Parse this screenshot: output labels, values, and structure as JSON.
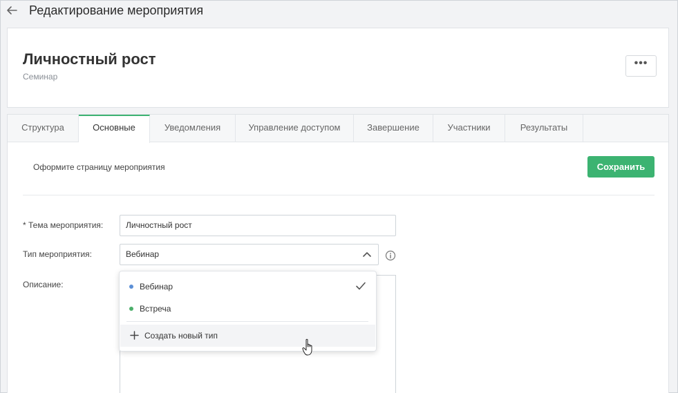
{
  "header": {
    "title": "Редактирование мероприятия"
  },
  "event": {
    "title": "Личностный рост",
    "subtitle": "Семинар",
    "more_label": "•••"
  },
  "tabs": [
    {
      "label": "Структура"
    },
    {
      "label": "Основные"
    },
    {
      "label": "Уведомления"
    },
    {
      "label": "Управление доступом"
    },
    {
      "label": "Завершение"
    },
    {
      "label": "Участники"
    },
    {
      "label": "Результаты"
    }
  ],
  "active_tab": "Основные",
  "section": {
    "label": "Оформите страницу мероприятия",
    "save_label": "Сохранить"
  },
  "form": {
    "topic_label": "* Тема мероприятия:",
    "topic_value": "Личностный рост",
    "type_label": "Тип мероприятия:",
    "type_value": "Вебинар",
    "description_label": "Описание:"
  },
  "dropdown": {
    "options": [
      {
        "label": "Вебинар",
        "color": "#5b8fd6",
        "selected": true
      },
      {
        "label": "Встреча",
        "color": "#4caf6a",
        "selected": false
      }
    ],
    "create_label": "Создать новый тип"
  },
  "colors": {
    "accent": "#3cb371"
  }
}
